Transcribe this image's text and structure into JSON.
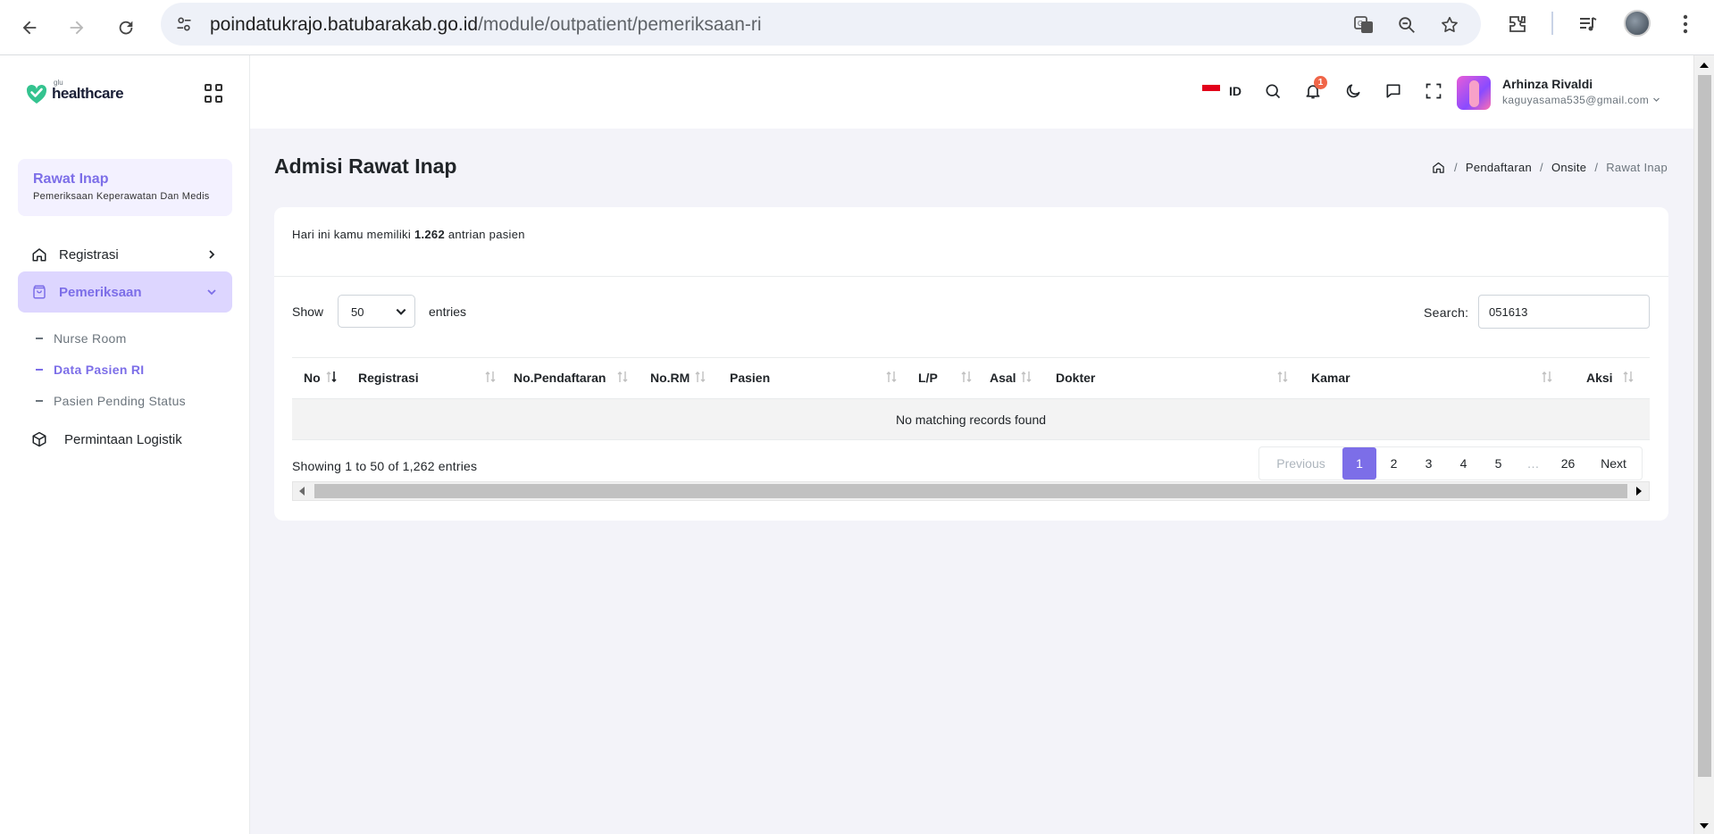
{
  "browser": {
    "url_host": "poindatukrajo.batubarakab.go.id",
    "url_path": "/module/outpatient/pemeriksaan-ri"
  },
  "brand": {
    "small": "glu",
    "name": "healthcare",
    "color": "#34c38f"
  },
  "sidebar": {
    "module_title": "Rawat Inap",
    "module_subtitle": "Pemeriksaan Keperawatan Dan Medis",
    "items": [
      {
        "label": "Registrasi",
        "icon": "home-icon"
      },
      {
        "label": "Pemeriksaan",
        "icon": "bag-icon"
      },
      {
        "label": "Permintaan Logistik",
        "icon": "box-icon"
      }
    ],
    "sub_items": [
      {
        "label": "Nurse Room"
      },
      {
        "label": "Data Pasien RI"
      },
      {
        "label": "Pasien Pending Status"
      }
    ],
    "accent_color": "#7c6ee8"
  },
  "topbar": {
    "language": "ID",
    "notification_count": "1",
    "user_name": "Arhinza Rivaldi",
    "user_email": "kaguyasama535@gmail.com"
  },
  "page": {
    "title": "Admisi Rawat Inap",
    "breadcrumb": [
      "Pendaftaran",
      "Onsite",
      "Rawat Inap"
    ]
  },
  "queue": {
    "prefix": "Hari ini kamu memiliki",
    "count": "1.262",
    "suffix": "antrian pasien"
  },
  "table": {
    "show_label": "Show",
    "page_size": "50",
    "entries_label": "entries",
    "search_label": "Search:",
    "search_value": "051613",
    "columns": [
      "No",
      "Registrasi",
      "No.Pendaftaran",
      "No.RM",
      "Pasien",
      "L/P",
      "Asal",
      "Dokter",
      "Kamar",
      "Aksi"
    ],
    "empty_message": "No matching records found",
    "info": "Showing 1 to 50 of 1,262 entries"
  },
  "pagination": {
    "previous": "Previous",
    "pages": [
      "1",
      "2",
      "3",
      "4",
      "5",
      "…",
      "26"
    ],
    "current": "1",
    "next": "Next"
  }
}
